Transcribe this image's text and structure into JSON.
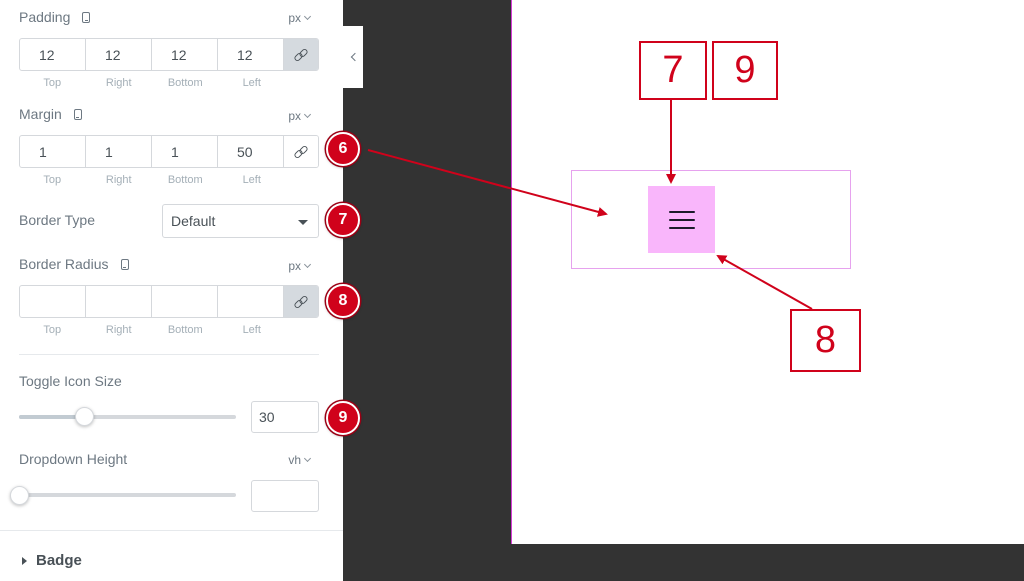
{
  "panel": {
    "padding": {
      "label": "Padding",
      "unit": "px",
      "values": [
        "12",
        "12",
        "12",
        "12"
      ],
      "sides": [
        "Top",
        "Right",
        "Bottom",
        "Left"
      ]
    },
    "margin": {
      "label": "Margin",
      "unit": "px",
      "values": [
        "1",
        "1",
        "1",
        "50"
      ],
      "sides": [
        "Top",
        "Right",
        "Bottom",
        "Left"
      ]
    },
    "border_type": {
      "label": "Border Type",
      "selected": "Default"
    },
    "border_radius": {
      "label": "Border Radius",
      "unit": "px",
      "values": [
        "",
        "",
        "",
        ""
      ],
      "sides": [
        "Top",
        "Right",
        "Bottom",
        "Left"
      ]
    },
    "toggle_icon_size": {
      "label": "Toggle Icon Size",
      "value": "30",
      "slider_fraction": 0.3
    },
    "dropdown_height": {
      "label": "Dropdown Height",
      "unit": "vh",
      "value": "",
      "slider_fraction": 0
    },
    "badge_section": {
      "label": "Badge"
    }
  },
  "annotations": {
    "callouts": [
      "6",
      "7",
      "8",
      "9"
    ],
    "boxes": [
      "7",
      "9",
      "8"
    ]
  },
  "colors": {
    "callout_red": "#d0021b",
    "toggle_bg": "#f9b6fb",
    "container_border": "#e6a2ee"
  }
}
